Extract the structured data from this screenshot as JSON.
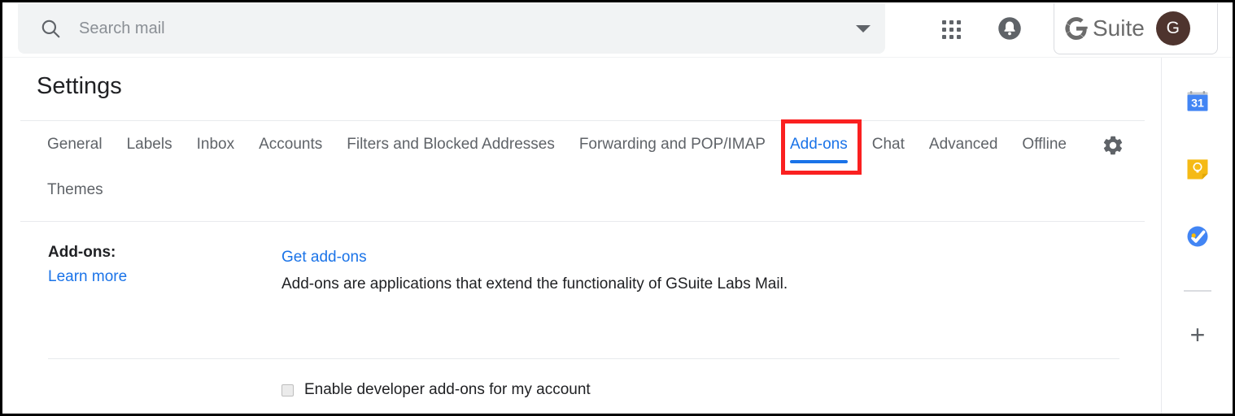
{
  "header": {
    "search": {
      "icon": "search-icon",
      "placeholder": "Search mail",
      "value": "",
      "options_icon": "chevron-down-icon"
    },
    "apps_icon": "apps-grid-icon",
    "notifications_icon": "bell-icon",
    "account": {
      "brand": "Suite",
      "brand_mark": "G",
      "avatar_initial": "G",
      "avatar_color": "#4e342e"
    }
  },
  "main": {
    "page_title": "Settings",
    "gear_icon": "gear-icon",
    "tabs": [
      {
        "label": "General",
        "active": false
      },
      {
        "label": "Labels",
        "active": false
      },
      {
        "label": "Inbox",
        "active": false
      },
      {
        "label": "Accounts",
        "active": false
      },
      {
        "label": "Filters and Blocked Addresses",
        "active": false
      },
      {
        "label": "Forwarding and POP/IMAP",
        "active": false
      },
      {
        "label": "Add-ons",
        "active": true
      },
      {
        "label": "Chat",
        "active": false
      },
      {
        "label": "Advanced",
        "active": false
      },
      {
        "label": "Offline",
        "active": false
      },
      {
        "label": "Themes",
        "active": false
      }
    ],
    "active_tab": "Add-ons",
    "content": {
      "section_label": "Add-ons:",
      "learn_more": "Learn more",
      "get_addons": "Get add-ons",
      "description": "Add-ons are applications that extend the functionality of GSuite Labs Mail.",
      "developer_checkbox": {
        "label": "Enable developer add-ons for my account",
        "checked": false
      }
    }
  },
  "right_sidebar": {
    "items": [
      {
        "name": "calendar-icon",
        "label": "Calendar",
        "day": "31"
      },
      {
        "name": "keep-icon",
        "label": "Keep"
      },
      {
        "name": "tasks-icon",
        "label": "Tasks"
      }
    ],
    "add_label": "+"
  },
  "colors": {
    "accent_blue": "#1a73e8",
    "annotation_red": "#fa2020",
    "text_primary": "#202124",
    "text_secondary": "#5f6368",
    "search_bg": "#f1f3f4"
  }
}
